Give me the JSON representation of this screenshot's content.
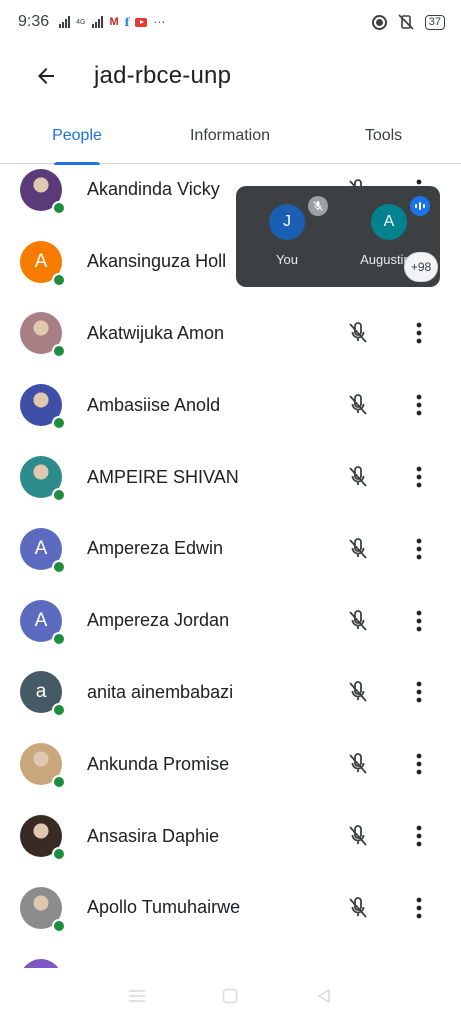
{
  "status_bar": {
    "time": "9:36",
    "network_tag": "4G",
    "notification_icons": [
      "gmail-icon",
      "facebook-icon",
      "youtube-icon"
    ],
    "gmail_glyph": "M",
    "facebook_glyph": "f",
    "more_glyph": "⋯",
    "battery": "37"
  },
  "app_bar": {
    "meeting_code": "jad-rbce-unp"
  },
  "tabs": [
    {
      "label": "People",
      "selected": true
    },
    {
      "label": "Information",
      "selected": false
    },
    {
      "label": "Tools",
      "selected": false
    }
  ],
  "participants": [
    {
      "name": "Akandinda Vicky",
      "initial": "",
      "avatar_color": "#5b3a7a",
      "photo": true,
      "online": true,
      "muted": true
    },
    {
      "name": "Akansinguza Holl",
      "initial": "A",
      "avatar_color": "#f57c00",
      "photo": false,
      "online": true,
      "muted": true
    },
    {
      "name": "Akatwijuka Amon",
      "initial": "",
      "avatar_color": "#a97f86",
      "photo": true,
      "online": true,
      "muted": true
    },
    {
      "name": "Ambasiise Anold",
      "initial": "",
      "avatar_color": "#3f4fa8",
      "photo": true,
      "online": true,
      "muted": true
    },
    {
      "name": "AMPEIRE SHIVAN",
      "initial": "",
      "avatar_color": "#2e8b8b",
      "photo": true,
      "online": true,
      "muted": true
    },
    {
      "name": "Ampereza Edwin",
      "initial": "A",
      "avatar_color": "#5c6bc0",
      "photo": false,
      "online": true,
      "muted": true
    },
    {
      "name": "Ampereza Jordan",
      "initial": "A",
      "avatar_color": "#5c6bc0",
      "photo": false,
      "online": true,
      "muted": true
    },
    {
      "name": "anita ainembabazi",
      "initial": "a",
      "avatar_color": "#455a64",
      "photo": false,
      "online": true,
      "muted": true
    },
    {
      "name": "Ankunda Promise",
      "initial": "",
      "avatar_color": "#c9a77c",
      "photo": true,
      "online": true,
      "muted": true
    },
    {
      "name": "Ansasira Daphie",
      "initial": "",
      "avatar_color": "#3a2a24",
      "photo": true,
      "online": true,
      "muted": true
    },
    {
      "name": "Apollo Tumuhairwe",
      "initial": "",
      "avatar_color": "#8c8c8c",
      "photo": true,
      "online": true,
      "muted": true
    },
    {
      "name": "",
      "initial": "",
      "avatar_color": "#7e57c2",
      "photo": false,
      "online": false,
      "muted": true
    }
  ],
  "pip": {
    "self": {
      "label": "You",
      "initial": "J",
      "color": "#1a5fb4",
      "muted": true
    },
    "other": {
      "label": "Augustine",
      "initial": "A",
      "color": "#00838f",
      "speaking": true
    },
    "extra_count": "+98"
  },
  "colors": {
    "accent": "#1a73e8",
    "online": "#1e8e3e",
    "pip_bg": "#3c4043"
  }
}
